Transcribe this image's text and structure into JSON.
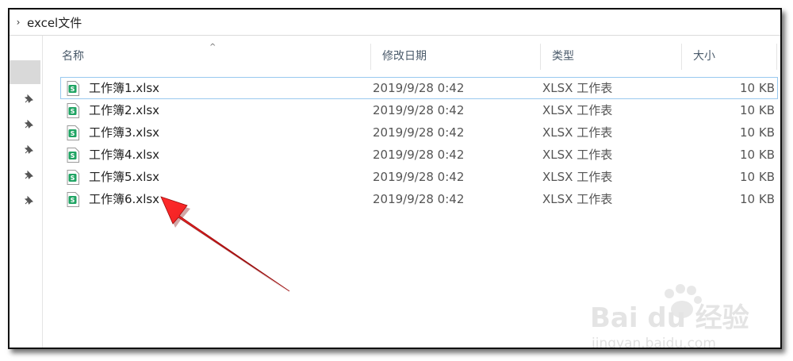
{
  "path": {
    "chevron": "›",
    "label": "excel文件"
  },
  "headers": {
    "name": "名称",
    "date": "修改日期",
    "type": "类型",
    "size": "大小",
    "sort_caret": "^"
  },
  "files": [
    {
      "name": "工作簿1.xlsx",
      "date": "2019/9/28 0:42",
      "type": "XLSX 工作表",
      "size": "10 KB"
    },
    {
      "name": "工作簿2.xlsx",
      "date": "2019/9/28 0:42",
      "type": "XLSX 工作表",
      "size": "10 KB"
    },
    {
      "name": "工作簿3.xlsx",
      "date": "2019/9/28 0:42",
      "type": "XLSX 工作表",
      "size": "10 KB"
    },
    {
      "name": "工作簿4.xlsx",
      "date": "2019/9/28 0:42",
      "type": "XLSX 工作表",
      "size": "10 KB"
    },
    {
      "name": "工作簿5.xlsx",
      "date": "2019/9/28 0:42",
      "type": "XLSX 工作表",
      "size": "10 KB"
    },
    {
      "name": "工作簿6.xlsx",
      "date": "2019/9/28 0:42",
      "type": "XLSX 工作表",
      "size": "10 KB"
    }
  ],
  "icons": {
    "file": "xlsx-file-icon",
    "pin": "pin-icon",
    "arrow": "red-arrow-annotation"
  },
  "watermark": {
    "brand": "Bai du 经验",
    "url": "jingyan.baidu.com"
  },
  "colors": {
    "arrow": "#e8141b",
    "xlsx_green": "#1fa463",
    "selection": "#99c9ef"
  }
}
